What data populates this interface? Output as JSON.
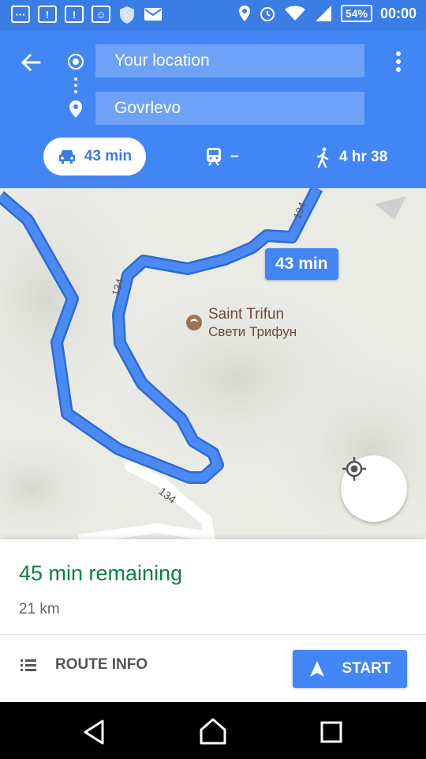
{
  "status_bar": {
    "battery": "54%",
    "time": "00:00",
    "left_icons": [
      "message-icon",
      "alert-icon",
      "alert-icon",
      "screenshot-icon",
      "shield-icon",
      "mail-icon"
    ],
    "right_icons": [
      "location-icon",
      "alarm-icon",
      "wifi-icon",
      "signal-icon",
      "battery-icon"
    ]
  },
  "header": {
    "origin": "Your location",
    "destination": "Govrlevo",
    "modes": [
      {
        "name": "drive",
        "icon": "car-icon",
        "label": "43 min",
        "selected": true
      },
      {
        "name": "transit",
        "icon": "train-icon",
        "label": "–",
        "selected": false
      },
      {
        "name": "walk",
        "icon": "walk-icon",
        "label": "4 hr 38",
        "selected": false
      }
    ]
  },
  "map": {
    "eta_badge": "43 min",
    "road_label": "134",
    "poi_name": "Saint Trifun",
    "poi_name_local": "Свети Трифун",
    "route_color": "#4a8af4"
  },
  "sheet": {
    "remaining": "45 min remaining",
    "distance": "21 km",
    "route_info_label": "ROUTE INFO",
    "start_label": "START"
  },
  "colors": {
    "header": "#4285f4",
    "status_bar": "#3a7de6",
    "remaining_text": "#0b8043"
  }
}
